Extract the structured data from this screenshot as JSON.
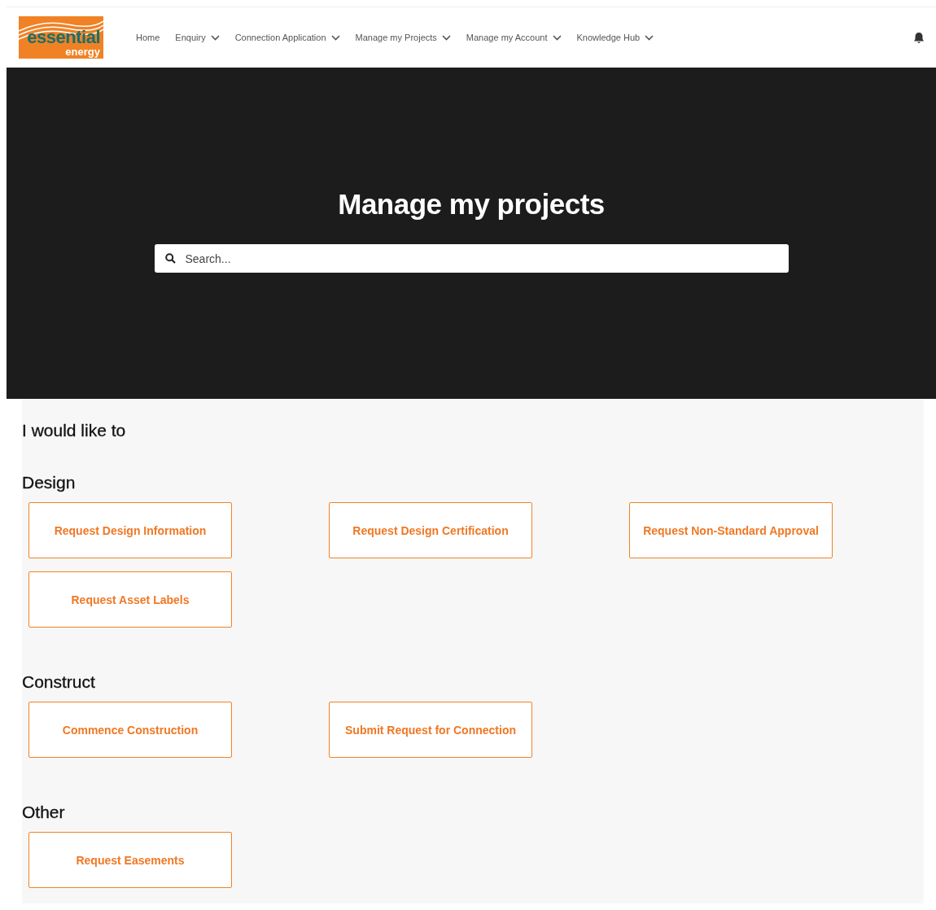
{
  "logo": {
    "line_1": "essential",
    "line_2": "energy"
  },
  "nav": [
    {
      "label": "Home",
      "has_menu": false
    },
    {
      "label": "Enquiry",
      "has_menu": true
    },
    {
      "label": "Connection Application",
      "has_menu": true
    },
    {
      "label": "Manage my Projects",
      "has_menu": true
    },
    {
      "label": "Manage my Account",
      "has_menu": true
    },
    {
      "label": "Knowledge Hub",
      "has_menu": true
    }
  ],
  "hero": {
    "title": "Manage my projects",
    "search": {
      "placeholder": "Search..."
    }
  },
  "intro": "I would like to",
  "sections": [
    {
      "title": "Design",
      "actions": [
        "Request Design Information",
        "Request Design Certification",
        "Request Non-Standard Approval",
        "Request Asset Labels"
      ]
    },
    {
      "title": "Construct",
      "actions": [
        "Commence Construction",
        "Submit Request for Connection"
      ]
    },
    {
      "title": "Other",
      "actions": [
        "Request Easements"
      ]
    }
  ]
}
